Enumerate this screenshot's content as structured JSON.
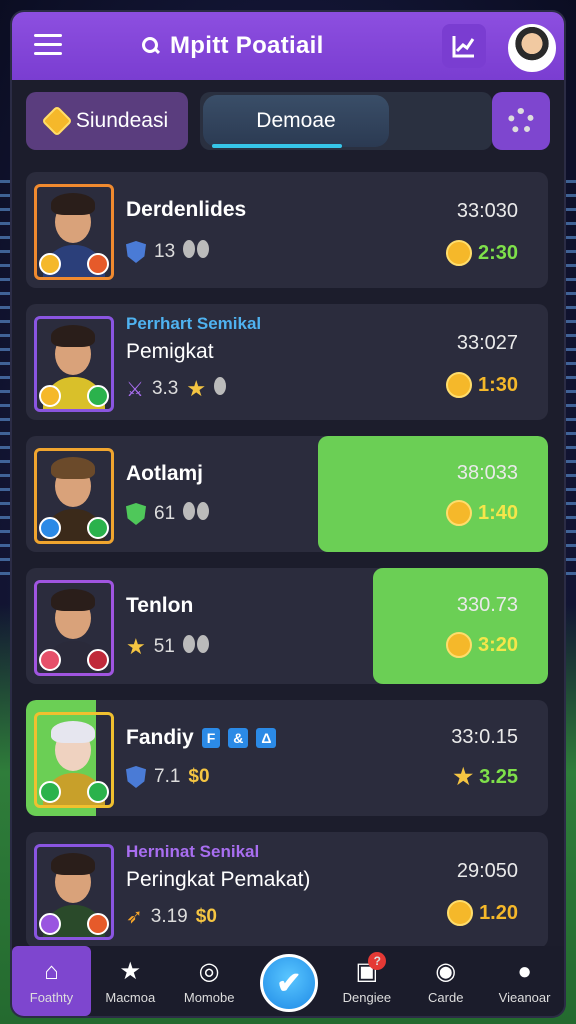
{
  "header": {
    "title": "Mpitt Poatiail",
    "menu_icon": "hamburger-menu-icon",
    "chart_icon": "chart-icon",
    "search_icon": "search-icon"
  },
  "tabs": {
    "left_label": "Siundeasi",
    "middle_label": "Demoae",
    "settings_icon": "gear-icon"
  },
  "rows": [
    {
      "tag": "",
      "name": "Derdenlides",
      "stat_value": "13",
      "time": "33:030",
      "coin_value": "2:30",
      "highlight": false
    },
    {
      "tag": "Perrhart Semikal",
      "name": "Pemigkat",
      "stat_value": "3.3",
      "time": "33:027",
      "coin_value": "1:30",
      "highlight": false
    },
    {
      "tag": "",
      "name": "Aotlamj",
      "stat_value": "61",
      "time": "38:033",
      "coin_value": "1:40",
      "highlight": true
    },
    {
      "tag": "",
      "name": "Tenlon",
      "stat_value": "51",
      "time": "330.73",
      "coin_value": "3:20",
      "highlight": true
    },
    {
      "tag": "",
      "name": "Fandiy",
      "stat_value": "7.1",
      "bonus": "$0",
      "time": "33:0.15",
      "coin_value": "3.25",
      "highlight": false
    },
    {
      "tag": "Herninat Senikal",
      "name": "Peringkat Pemakat)",
      "stat_value": "3.19",
      "bonus": "$0",
      "time": "29:050",
      "coin_value": "1.20",
      "highlight": false
    }
  ],
  "row4_badges": [
    "F",
    "&",
    "Δ"
  ],
  "nav": [
    {
      "label": "Foathty",
      "icon": "home-icon"
    },
    {
      "label": "Macmoa",
      "icon": "star-icon"
    },
    {
      "label": "Momobe",
      "icon": "search-icon"
    },
    {
      "label": "",
      "icon": "check-icon"
    },
    {
      "label": "Dengiee",
      "icon": "shop-icon"
    },
    {
      "label": "Carde",
      "icon": "profile-search-icon"
    },
    {
      "label": "Vieanoar",
      "icon": "user-icon"
    }
  ],
  "nav_badge": "?",
  "colors": {
    "header": "#7a3dd1",
    "panel": "#2b2c3d",
    "highlight": "#6bcf55",
    "coin": "#f5b82a",
    "accent_cyan": "#36c5e8"
  }
}
